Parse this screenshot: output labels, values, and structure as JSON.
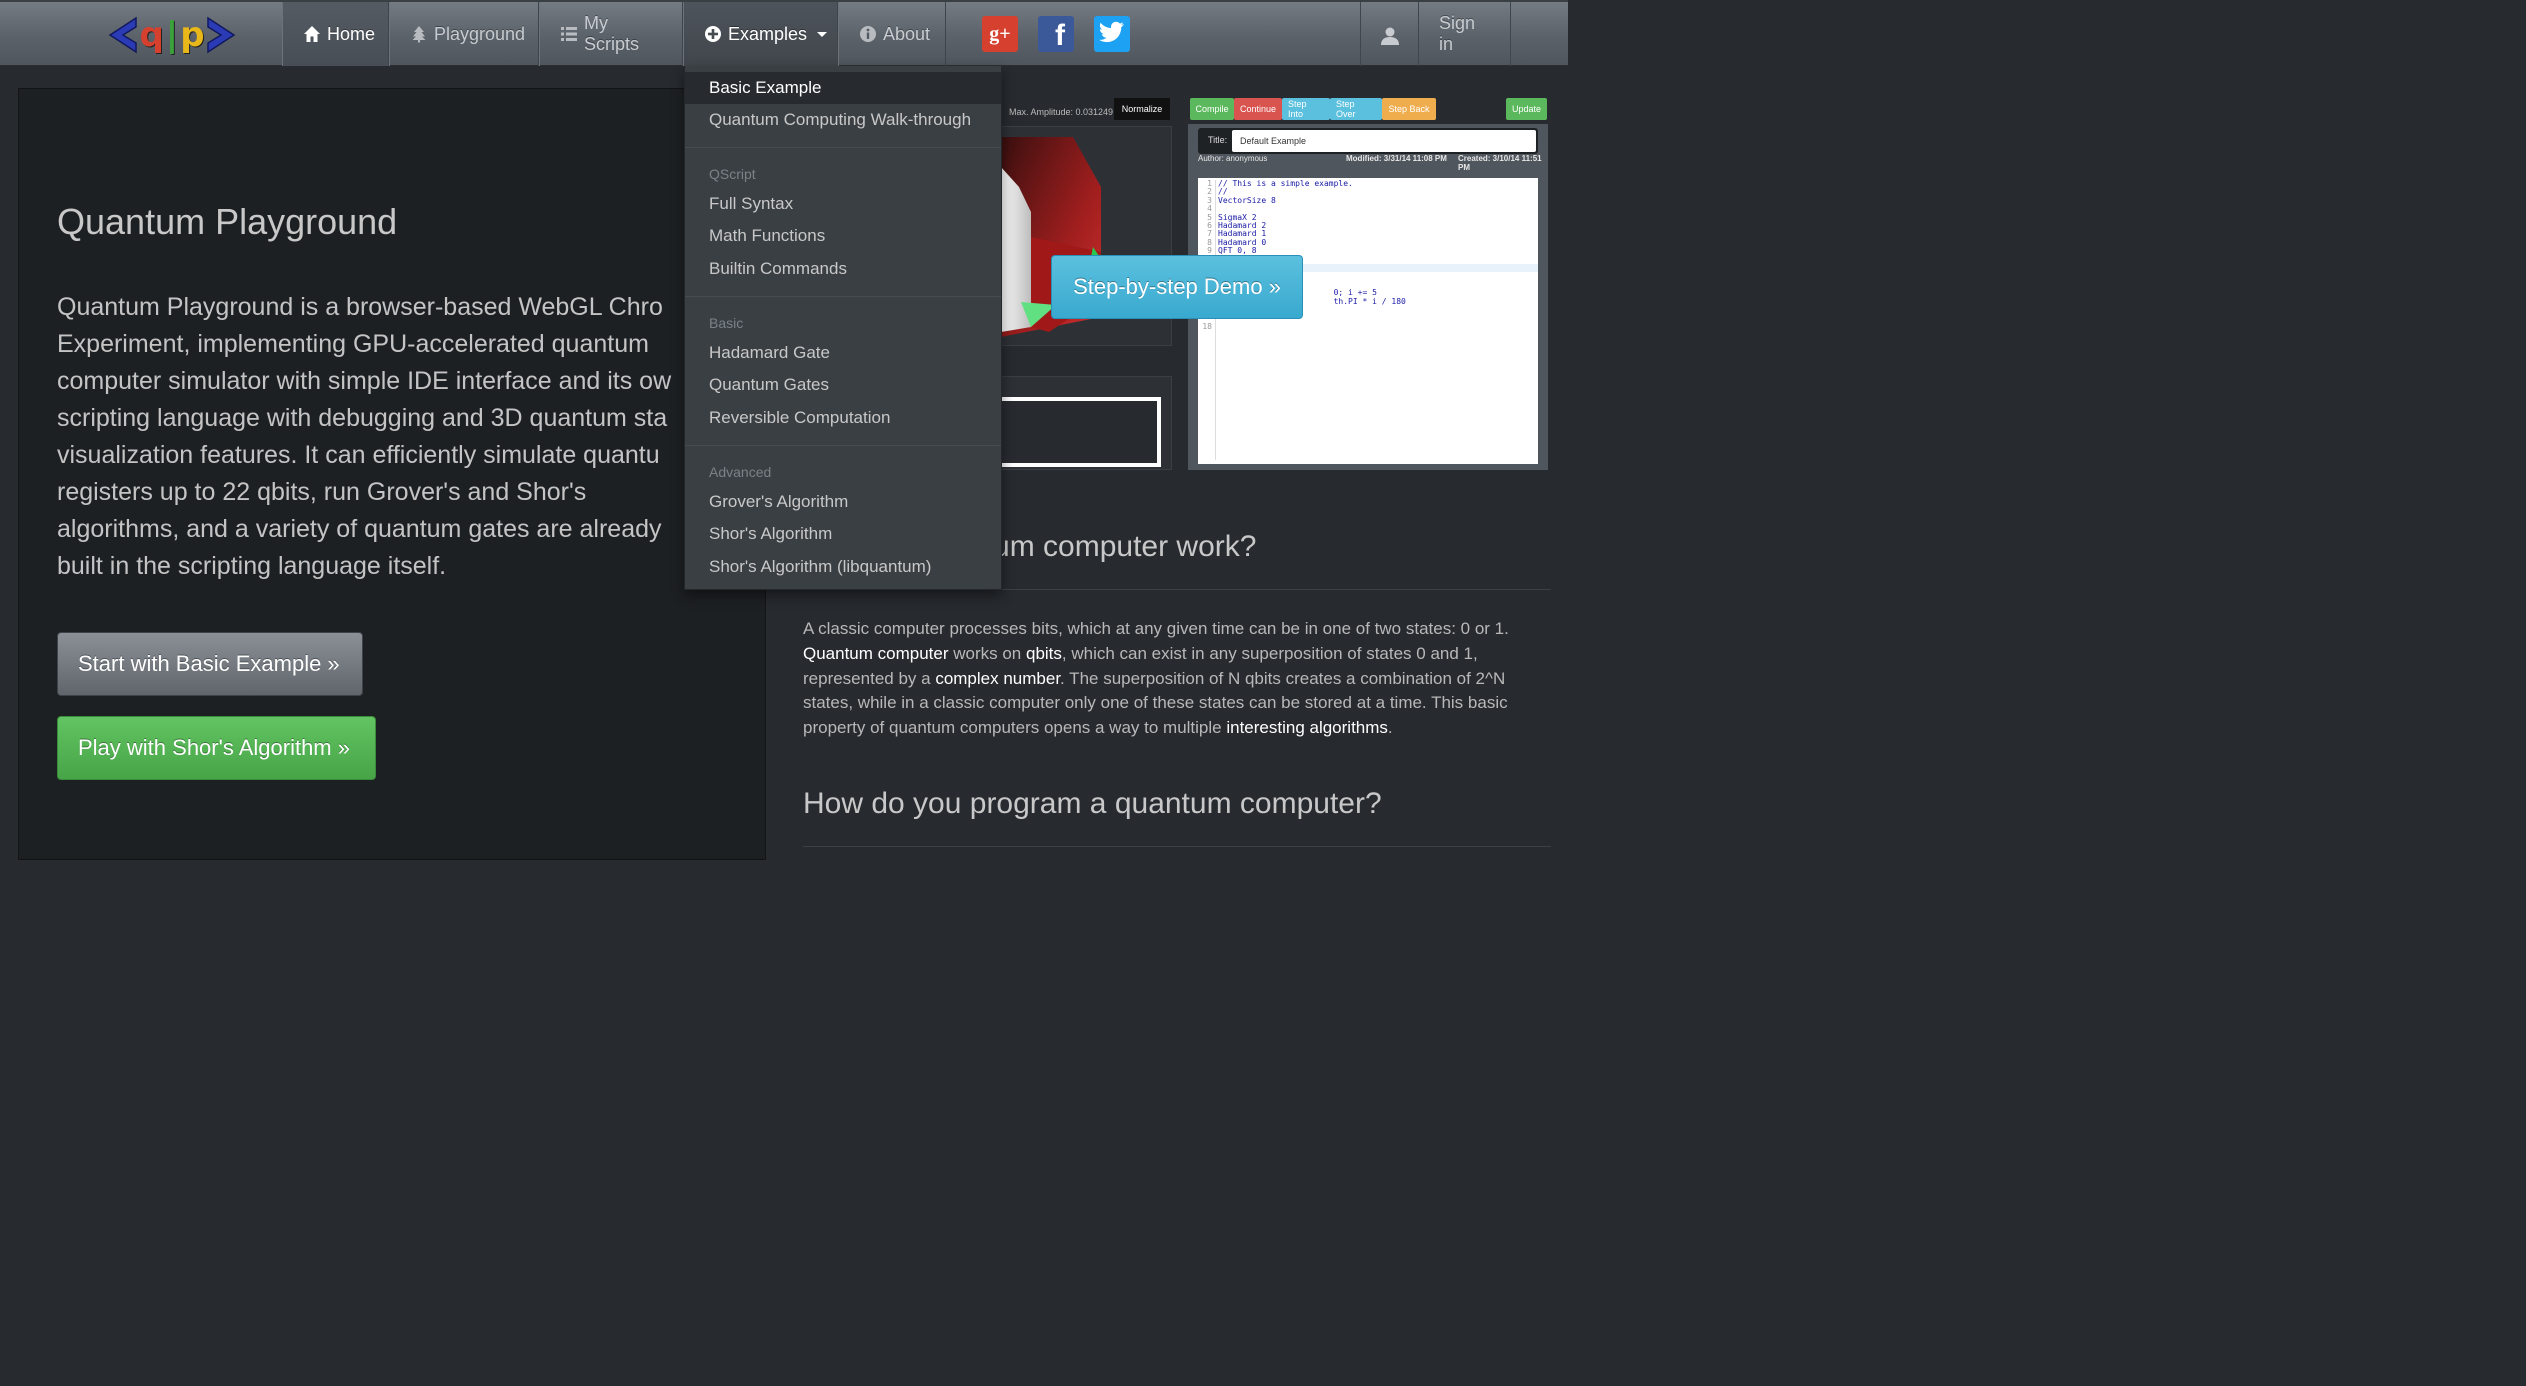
{
  "navbar": {
    "logo": {
      "chars": [
        "<",
        "q",
        "|",
        "p",
        ">"
      ],
      "colors": [
        "#2a3bb5",
        "#d6402e",
        "#3aa33a",
        "#e8b81a",
        "#2a3bb5"
      ]
    },
    "items": [
      {
        "label": "Home",
        "icon": "home-icon"
      },
      {
        "label": "Playground",
        "icon": "tree-icon"
      },
      {
        "label": "My Scripts",
        "icon": "list-icon"
      },
      {
        "label": "Examples",
        "icon": "plus-circle-icon"
      },
      {
        "label": "About",
        "icon": "info-icon"
      }
    ],
    "social": {
      "gplus": "g+",
      "facebook": "f",
      "twitter": "twitter-bird-icon"
    },
    "signin": "Sign in"
  },
  "dropdown": {
    "items_top": [
      "Basic Example",
      "Quantum Computing Walk-through"
    ],
    "groups": [
      {
        "header": "QScript",
        "items": [
          "Full Syntax",
          "Math Functions",
          "Builtin Commands"
        ]
      },
      {
        "header": "Basic",
        "items": [
          "Hadamard Gate",
          "Quantum Gates",
          "Reversible Computation"
        ]
      },
      {
        "header": "Advanced",
        "items": [
          "Grover's Algorithm",
          "Shor's Algorithm",
          "Shor's Algorithm (libquantum)"
        ]
      }
    ]
  },
  "jumbotron": {
    "title": "Quantum Playground",
    "lines": [
      "Quantum Playground is a browser-based WebGL Chro",
      "Experiment, implementing GPU-accelerated quantum",
      "computer simulator with simple IDE interface and its ow",
      "scripting language with debugging and 3D quantum sta",
      "visualization features. It can efficiently simulate quantu",
      "registers up to 22 qbits, run Grover's and Shor's",
      "algorithms, and a variety of quantum gates are already",
      "built in the scripting language itself."
    ],
    "btn_basic": "Start with Basic Example »",
    "btn_shor": "Play with Shor's Algorithm »"
  },
  "visualizer": {
    "amplitude": "Max. Amplitude: 0.031249",
    "normalize": "Normalize"
  },
  "ide": {
    "buttons": [
      "Compile",
      "Continue",
      "Step Into",
      "Step Over",
      "Step Back"
    ],
    "button_colors": [
      "#5cb85c",
      "#d9534f",
      "#5bc0de",
      "#5bc0de",
      "#f0ad4e"
    ],
    "update": "Update",
    "title_label": "Title:",
    "title_value": "Default Example",
    "author": "Author: anonymous",
    "modified": "Modified: 3/31/14 11:08 PM",
    "created": "Created: 3/10/14 11:51 PM",
    "line_numbers": "1\n2\n3\n4\n5\n6\n7\n8\n9\n\n\n\n\n\n\n\n\n18",
    "code": "// This is a simple example.\n//\nVectorSize 8\n\nSigmaX 2\nHadamard 2\nHadamard 1\nHadamard 0\nQFT 0, 8\n\n\n\n\n                        0; i += 5\n                        th.PI * i / 180\n"
  },
  "demo_button": "Step-by-step Demo »",
  "section1": {
    "heading": "ntum computer work?",
    "p_parts": [
      "A classic computer processes bits, which at any given time can be in one of two states: 0 or 1. ",
      "Quantum computer",
      " works on ",
      "qbits",
      ", which can exist in any superposition of states 0 and 1, represented by a ",
      "complex number",
      ". The superposition of N qbits creates a combination of 2^N states, while in a classic computer only one of these states can be stored at a time. This basic property of quantum computers opens a way to multiple ",
      "interesting algorithms",
      "."
    ]
  },
  "section2": {
    "heading": "How do you program a quantum computer?"
  }
}
